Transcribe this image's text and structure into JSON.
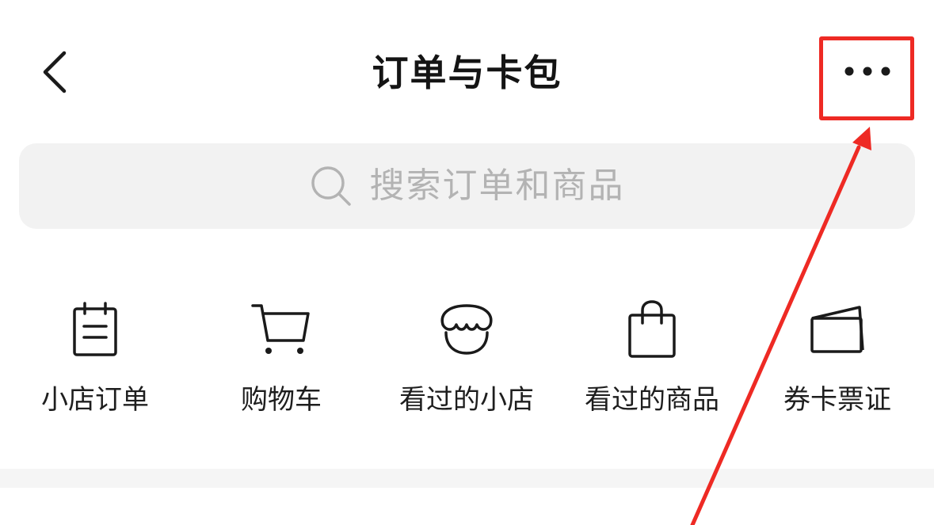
{
  "header": {
    "title": "订单与卡包",
    "back_icon": "chevron-left-icon",
    "more_icon": "more-horizontal-icon"
  },
  "search": {
    "placeholder": "搜索订单和商品",
    "icon": "search-icon"
  },
  "shortcuts": [
    {
      "label": "小店订单",
      "icon": "clipboard-list-icon"
    },
    {
      "label": "购物车",
      "icon": "shopping-cart-icon"
    },
    {
      "label": "看过的小店",
      "icon": "shop-awning-icon"
    },
    {
      "label": "看过的商品",
      "icon": "shopping-bag-icon"
    },
    {
      "label": "券卡票证",
      "icon": "ticket-card-icon"
    }
  ],
  "annotation": {
    "color": "#ee2a24",
    "target": "more-button"
  },
  "colors": {
    "search_bg": "#f2f2f2",
    "placeholder": "#b3b3b3",
    "divider": "#f5f5f5",
    "text": "#1a1a1a"
  }
}
